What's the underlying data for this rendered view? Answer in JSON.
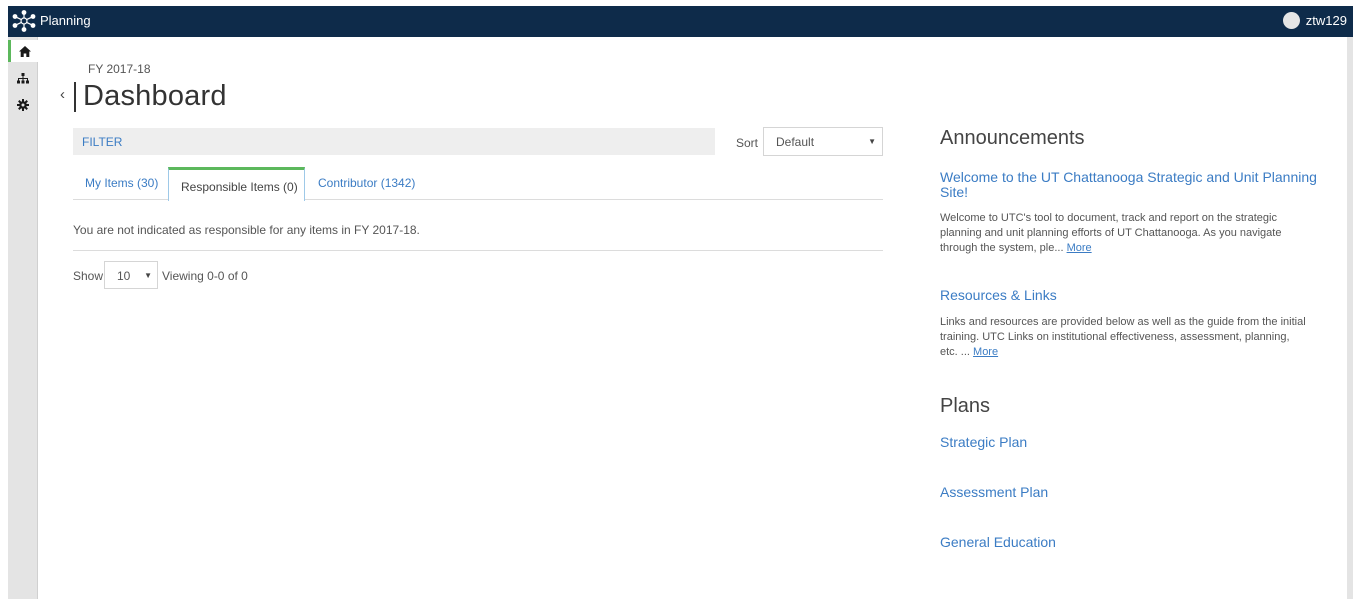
{
  "header": {
    "app_title": "Planning",
    "username": "ztw129"
  },
  "sidebar": {
    "items": [
      {
        "icon": "home-icon",
        "active": true
      },
      {
        "icon": "org-chart-icon",
        "active": false
      },
      {
        "icon": "gear-icon",
        "active": false
      }
    ]
  },
  "page": {
    "fiscal_year": "FY 2017-18",
    "back_glyph": "‹",
    "title": "Dashboard"
  },
  "filter": {
    "label": "FILTER"
  },
  "sort": {
    "label": "Sort",
    "selected": "Default",
    "caret": "▼"
  },
  "tabs": [
    {
      "label": "My Items (30)",
      "active": false
    },
    {
      "label": "Responsible Items (0)",
      "active": true
    },
    {
      "label": "Contributor (1342)",
      "active": false
    }
  ],
  "content": {
    "empty_message": "You are not indicated as responsible for any items in FY 2017-18."
  },
  "pagination": {
    "show_label": "Show",
    "page_size": "10",
    "caret": "▼",
    "viewing": "Viewing 0-0 of 0"
  },
  "announcements": {
    "heading": "Announcements",
    "items": [
      {
        "title": "Welcome to the UT Chattanooga Strategic and Unit Planning Site!",
        "body": "Welcome to UTC's tool to document, track and report on the strategic planning and unit planning efforts of UT Chattanooga. As you navigate through the system, ple...",
        "more": "More"
      },
      {
        "title": "Resources & Links",
        "body": "Links and resources are provided below as well as the guide from the initial training. UTC Links on institutional effectiveness, assessment, planning, etc. ...",
        "more": "More"
      }
    ]
  },
  "plans": {
    "heading": "Plans",
    "items": [
      {
        "label": "Strategic Plan"
      },
      {
        "label": "Assessment Plan"
      },
      {
        "label": "General Education"
      }
    ]
  },
  "colors": {
    "topbar": "#0e2b4a",
    "link": "#3b7cc4",
    "tab_accent": "#5cb85c"
  }
}
